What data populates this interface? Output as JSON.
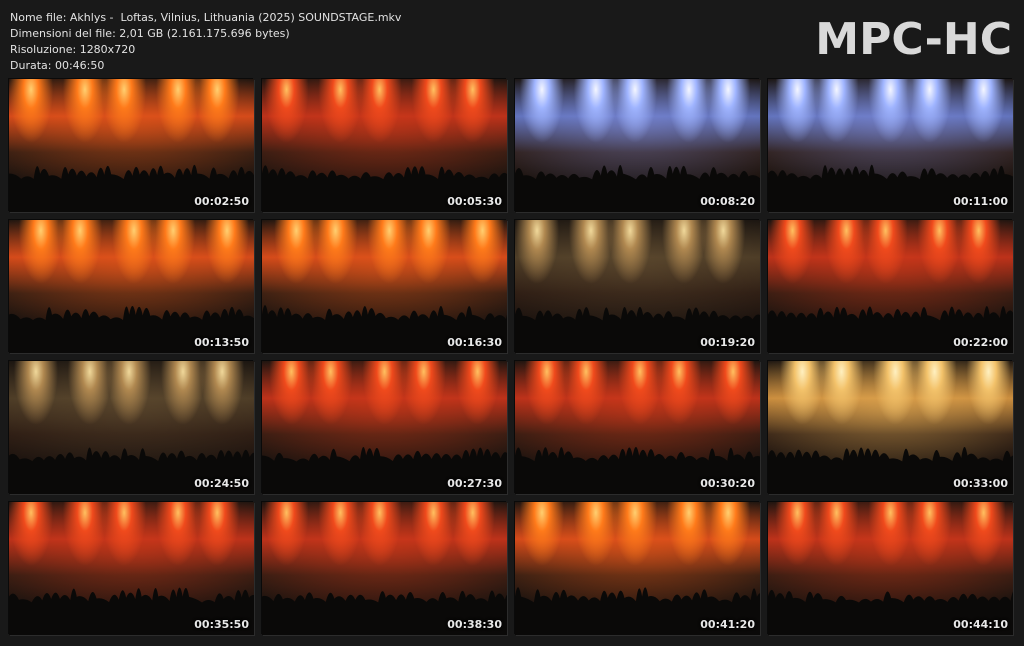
{
  "info": {
    "filename": "Nome file: Akhlys -  Loftas, Vilnius, Lithuania (2025) SOUNDSTAGE.mkv",
    "filesize": "Dimensioni del file: 2,01 GB (2.161.175.696 bytes)",
    "resolution": "Risoluzione: 1280x720",
    "duration": "Durata: 00:46:50"
  },
  "logo": "MPC-HC",
  "thumbnails": [
    {
      "time": "00:02:50",
      "tint": "orange"
    },
    {
      "time": "00:05:30",
      "tint": "red"
    },
    {
      "time": "00:08:20",
      "tint": "blue"
    },
    {
      "time": "00:11:00",
      "tint": "blue"
    },
    {
      "time": "00:13:50",
      "tint": "orange"
    },
    {
      "time": "00:16:30",
      "tint": "orange"
    },
    {
      "time": "00:19:20",
      "tint": "dark"
    },
    {
      "time": "00:22:00",
      "tint": "red"
    },
    {
      "time": "00:24:50",
      "tint": "dark"
    },
    {
      "time": "00:27:30",
      "tint": "red"
    },
    {
      "time": "00:30:20",
      "tint": "red"
    },
    {
      "time": "00:33:00",
      "tint": "yellow"
    },
    {
      "time": "00:35:50",
      "tint": "red"
    },
    {
      "time": "00:38:30",
      "tint": "red"
    },
    {
      "time": "00:41:20",
      "tint": "orange"
    },
    {
      "time": "00:44:10",
      "tint": "red"
    }
  ],
  "colors": {
    "background": "#191919",
    "orange": "#e0671c",
    "red": "#c8381a",
    "blue": "#8a9fd8",
    "yellow": "#e7b45a",
    "dark": "#6b5a3a"
  }
}
